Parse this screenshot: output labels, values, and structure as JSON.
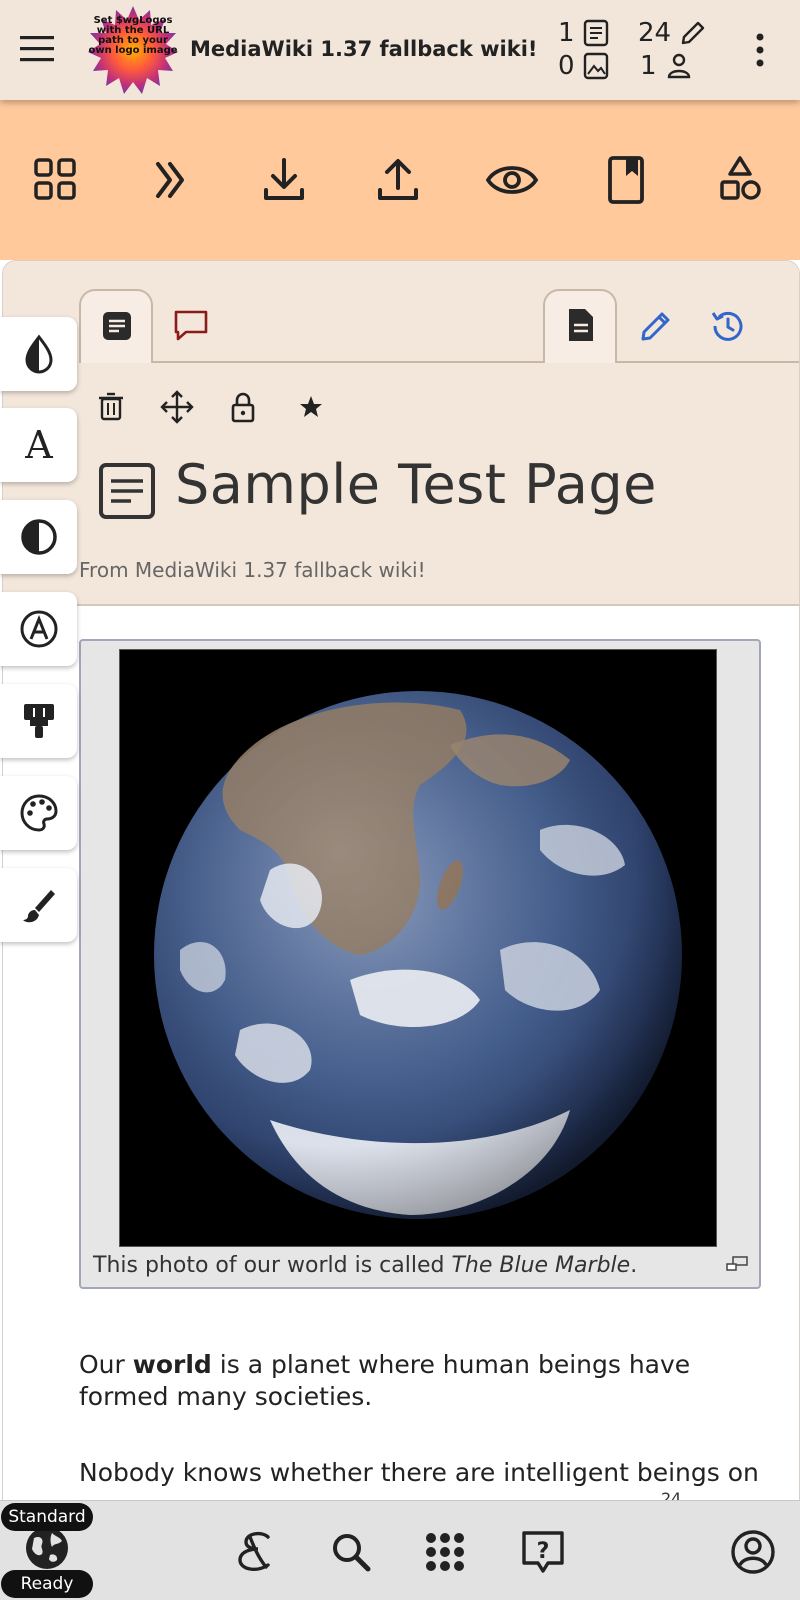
{
  "header": {
    "site_title": "MediaWiki 1.37 fallback wiki!",
    "logo_text": "Set $wgLogos with the URL path to your own logo image",
    "stats": {
      "articles": "1",
      "files": "0",
      "edits": "24",
      "users": "1"
    }
  },
  "toolbar": {
    "buttons": [
      {
        "icon": "grid-icon"
      },
      {
        "icon": "double-chevron-right-icon"
      },
      {
        "icon": "download-icon"
      },
      {
        "icon": "upload-icon"
      },
      {
        "icon": "eye-icon"
      },
      {
        "icon": "bookmark-icon"
      },
      {
        "icon": "shapes-icon"
      }
    ],
    "color": "#ffc99b"
  },
  "page": {
    "title": "Sample Test Page",
    "subtitle": "From MediaWiki 1.37 fallback wiki!",
    "tabs": {
      "left": [
        {
          "icon": "article-icon",
          "active": true
        },
        {
          "icon": "talk-icon",
          "active": false
        }
      ],
      "right": [
        {
          "icon": "read-icon",
          "active": true
        },
        {
          "icon": "edit-pencil-icon",
          "active": false
        },
        {
          "icon": "history-icon",
          "active": false
        }
      ]
    },
    "actions": [
      {
        "icon": "delete-icon"
      },
      {
        "icon": "move-icon"
      },
      {
        "icon": "protect-icon"
      },
      {
        "icon": "watch-star-icon"
      }
    ]
  },
  "figure": {
    "caption_prefix": "This photo of our world is called ",
    "caption_italic": "The Blue Marble",
    "caption_suffix": "."
  },
  "content": {
    "p1_before": "Our ",
    "p1_bold": "world",
    "p1_after": " is a planet where human beings have formed many societies.",
    "p2": "Nobody knows whether there are intelligent beings on",
    "p2_superscript": "24"
  },
  "side_tools": [
    {
      "icon": "contrast-drop-icon"
    },
    {
      "icon": "font-serif-icon"
    },
    {
      "icon": "half-circle-contrast-icon"
    },
    {
      "icon": "circled-a-icon"
    },
    {
      "icon": "paint-roller-icon"
    },
    {
      "icon": "palette-icon"
    },
    {
      "icon": "brush-icon"
    }
  ],
  "bottom_bar": {
    "mode_label": "Standard",
    "status_label": "Ready",
    "icons": [
      "globe-icon",
      "script-e-icon",
      "search-icon",
      "apps-grid-icon",
      "help-icon",
      "account-icon"
    ]
  },
  "colors": {
    "header_bg": "#f2e6da",
    "toolbar_bg": "#ffc99b",
    "link_blue": "#3366cc",
    "talk_red": "#8b1a1a"
  }
}
